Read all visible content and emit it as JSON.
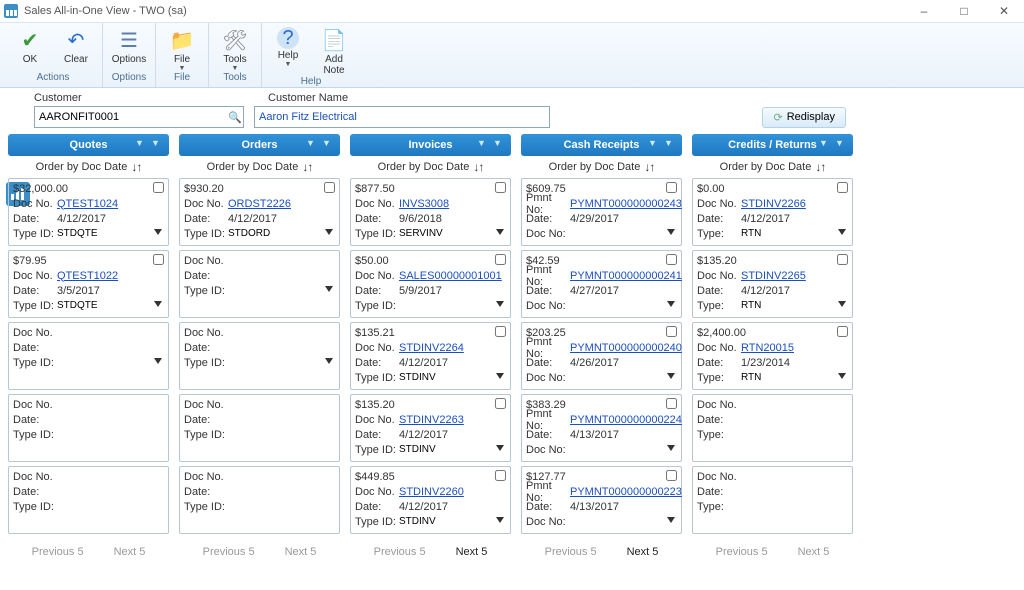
{
  "window": {
    "title": "Sales All-in-One View  -  TWO (sa)"
  },
  "ribbon": {
    "buttons": {
      "ok": "OK",
      "clear": "Clear",
      "options": "Options",
      "file": "File",
      "tools": "Tools",
      "help": "Help",
      "addnote": "Add\nNote"
    },
    "groups": {
      "actions": "Actions",
      "options": "Options",
      "file": "File",
      "tools": "Tools",
      "help": "Help"
    }
  },
  "customer": {
    "labelCustomer": "Customer",
    "labelName": "Customer Name",
    "id": "AARONFIT0001",
    "name": "Aaron Fitz Electrical",
    "redisplay": "Redisplay"
  },
  "orderByText": "Order by Doc Date",
  "pager": {
    "prev": "Previous 5",
    "next": "Next 5"
  },
  "cardLabels": {
    "docno": "Doc No.",
    "pmntno": "Pmnt No:",
    "date": "Date:",
    "type": "Type:",
    "typeid": "Type ID:",
    "docno2": "Doc No:"
  },
  "columns": [
    {
      "title": "Quotes",
      "cards": [
        {
          "amount": "$32,000.00",
          "docField": "docno",
          "doc": "QTEST1024",
          "link": true,
          "date": "4/12/2017",
          "typeField": "typeid",
          "type": "STDQTE",
          "sel": true
        },
        {
          "amount": "$79.95",
          "docField": "docno",
          "doc": "QTEST1022",
          "link": true,
          "date": "3/5/2017",
          "typeField": "typeid",
          "type": "STDQTE",
          "sel": true
        },
        {
          "amount": "",
          "docField": "docno",
          "doc": "",
          "date": "",
          "typeField": "typeid",
          "type": "",
          "sel": true
        },
        {
          "amount": "",
          "docField": "docno",
          "doc": "",
          "date": "",
          "typeField": "typeid",
          "type": ""
        },
        {
          "amount": "",
          "docField": "docno",
          "doc": "",
          "date": "",
          "typeField": "typeid",
          "type": ""
        }
      ],
      "nextActive": false
    },
    {
      "title": "Orders",
      "cards": [
        {
          "amount": "$930.20",
          "docField": "docno",
          "doc": "ORDST2226",
          "link": true,
          "date": "4/12/2017",
          "typeField": "typeid",
          "type": "STDORD",
          "sel": true
        },
        {
          "amount": "",
          "docField": "docno",
          "doc": "",
          "date": "",
          "typeField": "typeid",
          "type": "",
          "sel": true
        },
        {
          "amount": "",
          "docField": "docno",
          "doc": "",
          "date": "",
          "typeField": "typeid",
          "type": "",
          "sel": true
        },
        {
          "amount": "",
          "docField": "docno",
          "doc": "",
          "date": "",
          "typeField": "typeid",
          "type": ""
        },
        {
          "amount": "",
          "docField": "docno",
          "doc": "",
          "date": "",
          "typeField": "typeid",
          "type": ""
        }
      ],
      "nextActive": false
    },
    {
      "title": "Invoices",
      "cards": [
        {
          "amount": "$877.50",
          "docField": "docno",
          "doc": "INVS3008",
          "link": true,
          "date": "9/6/2018",
          "typeField": "typeid",
          "type": "SERVINV",
          "sel": true
        },
        {
          "amount": "$50.00",
          "docField": "docno",
          "doc": "SALES00000001001",
          "link": true,
          "date": "5/9/2017",
          "typeField": "typeid",
          "type": "",
          "sel": true
        },
        {
          "amount": "$135.21",
          "docField": "docno",
          "doc": "STDINV2264",
          "link": true,
          "date": "4/12/2017",
          "typeField": "typeid",
          "type": "STDINV",
          "sel": true
        },
        {
          "amount": "$135.20",
          "docField": "docno",
          "doc": "STDINV2263",
          "link": true,
          "date": "4/12/2017",
          "typeField": "typeid",
          "type": "STDINV",
          "sel": true
        },
        {
          "amount": "$449.85",
          "docField": "docno",
          "doc": "STDINV2260",
          "link": true,
          "date": "4/12/2017",
          "typeField": "typeid",
          "type": "STDINV",
          "sel": true
        }
      ],
      "nextActive": true
    },
    {
      "title": "Cash Receipts",
      "cards": [
        {
          "amount": "$609.75",
          "docField": "pmntno",
          "doc": "PYMNT000000000243",
          "link": true,
          "date": "4/29/2017",
          "typeField": "docno2",
          "type": "",
          "sel": true
        },
        {
          "amount": "$42.59",
          "docField": "pmntno",
          "doc": "PYMNT000000000241",
          "link": true,
          "date": "4/27/2017",
          "typeField": "docno2",
          "type": "",
          "sel": true
        },
        {
          "amount": "$203.25",
          "docField": "pmntno",
          "doc": "PYMNT000000000240",
          "link": true,
          "date": "4/26/2017",
          "typeField": "docno2",
          "type": "",
          "sel": true
        },
        {
          "amount": "$383.29",
          "docField": "pmntno",
          "doc": "PYMNT000000000224",
          "link": true,
          "date": "4/13/2017",
          "typeField": "docno2",
          "type": "",
          "sel": true
        },
        {
          "amount": "$127.77",
          "docField": "pmntno",
          "doc": "PYMNT000000000223",
          "link": true,
          "date": "4/13/2017",
          "typeField": "docno2",
          "type": "",
          "sel": true
        }
      ],
      "nextActive": true
    },
    {
      "title": "Credits / Returns",
      "cards": [
        {
          "amount": "$0.00",
          "docField": "docno",
          "doc": "STDINV2266",
          "link": true,
          "date": "4/12/2017",
          "typeField": "type",
          "type": "RTN",
          "sel": true
        },
        {
          "amount": "$135.20",
          "docField": "docno",
          "doc": "STDINV2265",
          "link": true,
          "date": "4/12/2017",
          "typeField": "type",
          "type": "RTN",
          "sel": true
        },
        {
          "amount": "$2,400.00",
          "docField": "docno",
          "doc": "RTN20015",
          "link": true,
          "date": "1/23/2014",
          "typeField": "type",
          "type": "RTN",
          "sel": true
        },
        {
          "amount": "",
          "docField": "docno",
          "doc": "",
          "date": "",
          "typeField": "type",
          "type": ""
        },
        {
          "amount": "",
          "docField": "docno",
          "doc": "",
          "date": "",
          "typeField": "type",
          "type": ""
        }
      ],
      "nextActive": false
    }
  ]
}
